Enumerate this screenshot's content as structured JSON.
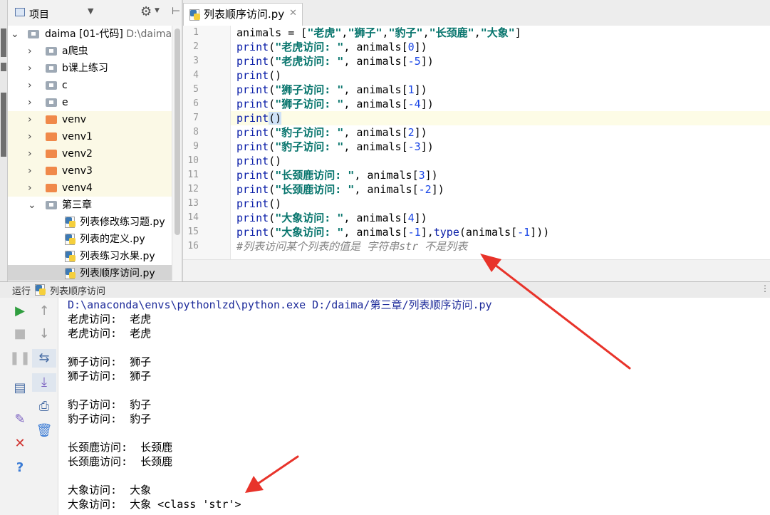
{
  "project_panel": {
    "title": "项目",
    "tree": [
      {
        "label": "daima [01-代码]",
        "path": "D:\\daima",
        "type": "root",
        "expanded": true
      },
      {
        "label": "a爬虫",
        "type": "folder"
      },
      {
        "label": "b课上练习",
        "type": "folder"
      },
      {
        "label": "c",
        "type": "folder"
      },
      {
        "label": "e",
        "type": "folder"
      },
      {
        "label": "venv",
        "type": "venv"
      },
      {
        "label": "venv1",
        "type": "venv"
      },
      {
        "label": "venv2",
        "type": "venv"
      },
      {
        "label": "venv3",
        "type": "venv"
      },
      {
        "label": "venv4",
        "type": "venv"
      },
      {
        "label": "第三章",
        "type": "folder",
        "expanded": true
      },
      {
        "label": "列表修改练习题.py",
        "type": "file"
      },
      {
        "label": "列表的定义.py",
        "type": "file"
      },
      {
        "label": "列表练习水果.py",
        "type": "file"
      },
      {
        "label": "列表顺序访问.py",
        "type": "file",
        "selected": true
      }
    ]
  },
  "editor": {
    "tab_label": "列表顺序访问.py",
    "line_numbers": [
      "1",
      "2",
      "3",
      "4",
      "5",
      "6",
      "7",
      "8",
      "9",
      "10",
      "11",
      "12",
      "13",
      "14",
      "15",
      "16"
    ],
    "current_line": 7,
    "lines": [
      "animals = [\"老虎\",\"狮子\",\"豹子\",\"长颈鹿\",\"大象\"]",
      "print(\"老虎访问: \", animals[0])",
      "print(\"老虎访问: \", animals[-5])",
      "print()",
      "print(\"狮子访问: \", animals[1])",
      "print(\"狮子访问: \", animals[-4])",
      "print()",
      "print(\"豹子访问: \", animals[2])",
      "print(\"豹子访问: \", animals[-3])",
      "print()",
      "print(\"长颈鹿访问: \", animals[3])",
      "print(\"长颈鹿访问: \", animals[-2])",
      "print()",
      "print(\"大象访问: \", animals[4])",
      "print(\"大象访问: \", animals[-1],type(animals[-1]))",
      "#列表访问某个列表的值是 字符串str 不是列表"
    ]
  },
  "run_panel": {
    "label": "运行",
    "config_name": "列表顺序访问",
    "output": [
      "D:\\anaconda\\envs\\pythonlzd\\python.exe D:/daima/第三章/列表顺序访问.py",
      "老虎访问:  老虎",
      "老虎访问:  老虎",
      "",
      "狮子访问:  狮子",
      "狮子访问:  狮子",
      "",
      "豹子访问:  豹子",
      "豹子访问:  豹子",
      "",
      "长颈鹿访问:  长颈鹿",
      "长颈鹿访问:  长颈鹿",
      "",
      "大象访问:  大象",
      "大象访问:  大象 <class 'str'>"
    ]
  },
  "colors": {
    "keyword": "#0b1fa8",
    "string": "#06746c",
    "number": "#1a46e6",
    "comment": "#858585",
    "annotation_arrow": "#e8332a",
    "venv_highlight": "#fbf9e6"
  }
}
